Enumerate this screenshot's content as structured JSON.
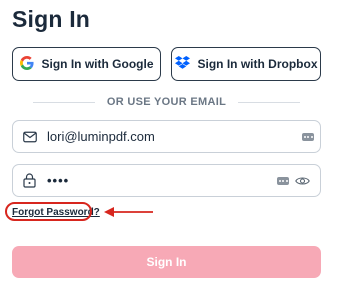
{
  "page": {
    "title": "Sign In"
  },
  "sso": {
    "google_label": "Sign In with Google",
    "dropbox_label": "Sign In with Dropbox"
  },
  "divider": {
    "text": "OR USE YOUR EMAIL"
  },
  "email": {
    "value": "lori@luminpdf.com",
    "icon": "mail-icon"
  },
  "password": {
    "value": "••••",
    "icon": "lock-icon"
  },
  "forgot": {
    "label": "Forgot Password?"
  },
  "submit": {
    "label": "Sign In",
    "color": "#f7a9b6"
  },
  "annotation": {
    "color": "#d7261e"
  }
}
